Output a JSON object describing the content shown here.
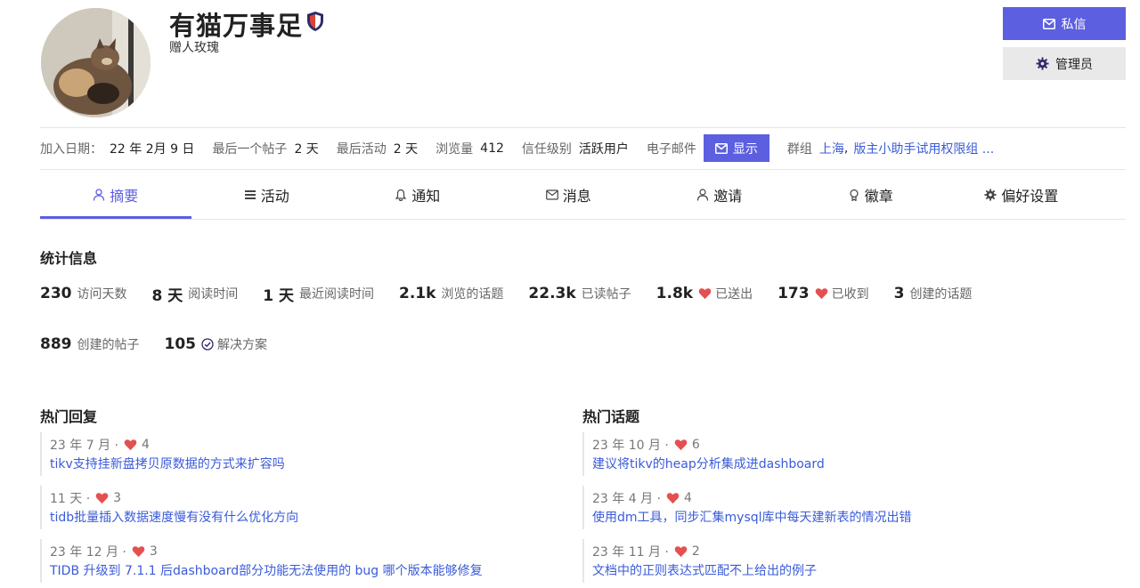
{
  "profile": {
    "username": "有猫万事足",
    "title": "赠人玫瑰"
  },
  "actions": {
    "message_label": "私信",
    "admin_label": "管理员"
  },
  "meta": {
    "joined_label": "加入日期：",
    "joined_value": "22 年 2月 9 日",
    "last_post_label": "最后一个帖子",
    "last_post_value": "2 天",
    "last_active_label": "最后活动",
    "last_active_value": "2 天",
    "views_label": "浏览量",
    "views_value": "412",
    "trust_label": "信任级别",
    "trust_value": "活跃用户",
    "email_label": "电子邮件",
    "show_label": "显示",
    "groups_label": "群组",
    "group1": "上海",
    "group_sep": ",",
    "group2": "版主小助手试用权限组 ..."
  },
  "tabs": [
    {
      "label": "摘要",
      "icon": "user-icon"
    },
    {
      "label": "活动",
      "icon": "stream-icon"
    },
    {
      "label": "通知",
      "icon": "bell-icon"
    },
    {
      "label": "消息",
      "icon": "envelope-icon"
    },
    {
      "label": "邀请",
      "icon": "user-plus-icon"
    },
    {
      "label": "徽章",
      "icon": "medal-icon"
    },
    {
      "label": "偏好设置",
      "icon": "cog-icon"
    }
  ],
  "stats": {
    "title": "统计信息",
    "items": [
      {
        "num": "230",
        "desc": "访问天数"
      },
      {
        "num": "8 天",
        "desc": "阅读时间"
      },
      {
        "num": "1 天",
        "desc": "最近阅读时间"
      },
      {
        "num": "2.1k",
        "desc": "浏览的话题"
      },
      {
        "num": "22.3k",
        "desc": "已读帖子"
      },
      {
        "num": "1.8k",
        "desc": "已送出"
      },
      {
        "num": "173",
        "desc": "已收到"
      },
      {
        "num": "3",
        "desc": "创建的话题"
      },
      {
        "num": "889",
        "desc": "创建的帖子"
      },
      {
        "num": "105",
        "desc": "解决方案"
      }
    ]
  },
  "top_replies": {
    "title": "热门回复",
    "items": [
      {
        "date": "23 年 7 月 ·",
        "likes": "4",
        "title": "tikv支持挂新盘拷贝原数据的方式来扩容吗"
      },
      {
        "date": "11 天 ·",
        "likes": "3",
        "title": "tidb批量插入数据速度慢有没有什么优化方向"
      },
      {
        "date": "23 年 12 月 ·",
        "likes": "3",
        "title": "TIDB 升级到 7.1.1 后dashboard部分功能无法使用的 bug 哪个版本能够修复"
      }
    ]
  },
  "top_topics": {
    "title": "热门话题",
    "items": [
      {
        "date": "23 年 10 月 ·",
        "likes": "6",
        "title": "建议将tikv的heap分析集成进dashboard"
      },
      {
        "date": "23 年 4 月 ·",
        "likes": "4",
        "title": "使用dm工具，同步汇集mysql库中每天建新表的情况出错"
      },
      {
        "date": "23 年 11 月 ·",
        "likes": "2",
        "title": "文档中的正则表达式匹配不上给出的例子"
      }
    ]
  },
  "colors": {
    "accent": "#5c5fe0",
    "link": "#3a5bd9",
    "heart": "#e45050"
  }
}
